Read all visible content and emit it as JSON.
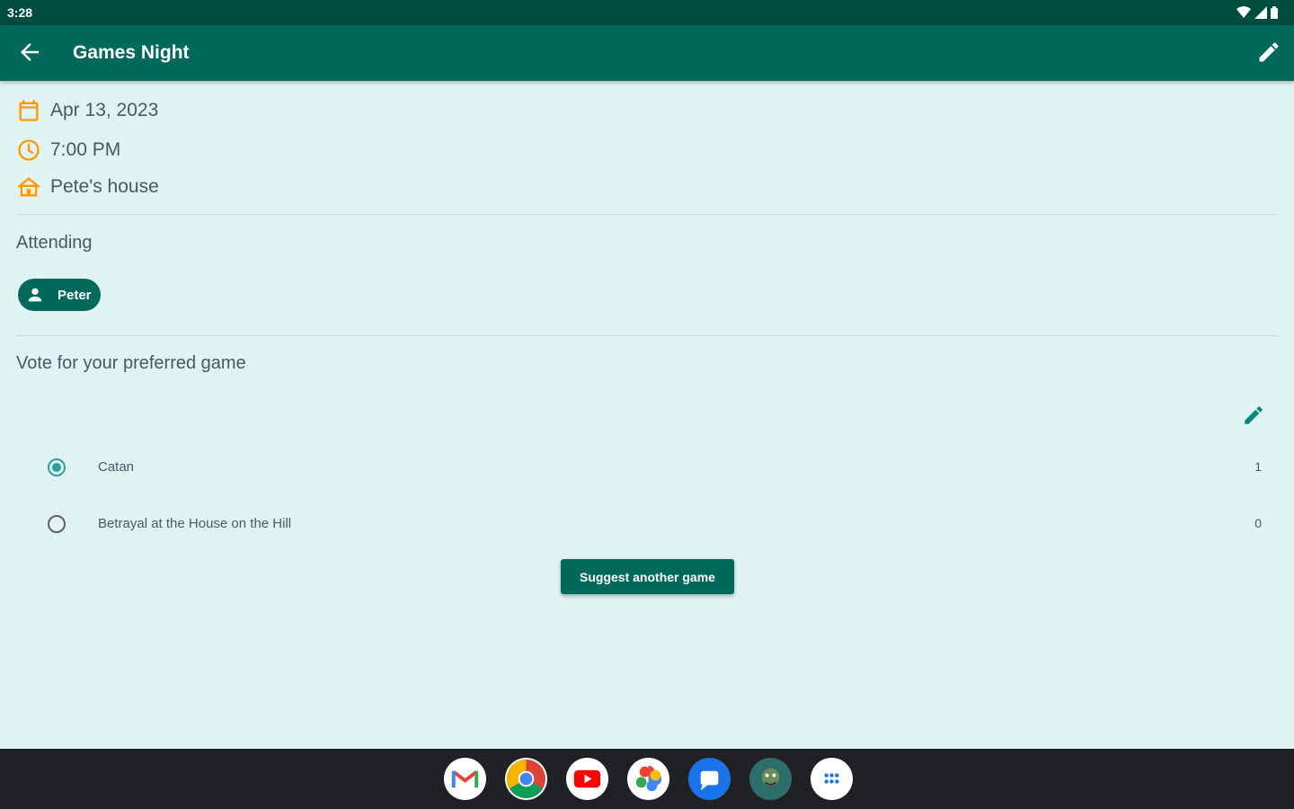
{
  "status_bar": {
    "time": "3:28"
  },
  "app_bar": {
    "title": "Games Night"
  },
  "event": {
    "date": "Apr 13, 2023",
    "time": "7:00 PM",
    "location": "Pete's house"
  },
  "attending": {
    "label": "Attending",
    "attendees": [
      {
        "name": "Peter"
      }
    ]
  },
  "poll": {
    "label": "Vote for your preferred game",
    "options": [
      {
        "name": "Catan",
        "votes": "1",
        "selected": true
      },
      {
        "name": "Betrayal at the House on the Hill",
        "votes": "0",
        "selected": false
      }
    ],
    "suggest_label": "Suggest another game"
  },
  "taskbar": {
    "apps": [
      "gmail-icon",
      "chrome-icon",
      "youtube-icon",
      "photos-icon",
      "messages-icon",
      "game-app-icon",
      "app-launcher-icon"
    ]
  },
  "colors": {
    "primary": "#00695c",
    "primary_dark": "#004d40",
    "background": "#e0f2f1",
    "accent_orange": "#ff9800"
  }
}
